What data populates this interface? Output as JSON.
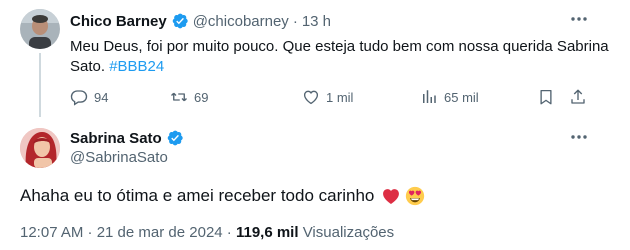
{
  "parent_tweet": {
    "author_name": "Chico Barney",
    "handle": "@chicobarney",
    "separator": "·",
    "time_ago": "13 h",
    "text_main": "Meu Deus, foi por muito pouco. Que esteja tudo bem com nossa querida Sabrina Sato.",
    "hashtag": "#BBB24",
    "actions": {
      "replies": "94",
      "retweets": "69",
      "likes": "1 mil",
      "views": "65 mil"
    },
    "icons": {
      "verified": "verified-badge-icon",
      "more": "more-icon",
      "reply": "reply-icon",
      "retweet": "retweet-icon",
      "like": "heart-icon",
      "views": "views-icon",
      "bookmark": "bookmark-icon",
      "share": "share-icon"
    }
  },
  "main_tweet": {
    "author_name": "Sabrina Sato",
    "handle": "@SabrinaSato",
    "text": "Ahaha eu to ótima e amei receber todo carinho",
    "emojis": [
      "red-heart-icon",
      "heart-eyes-icon"
    ],
    "timestamp": "12:07 AM · 21 de mar de 2024 ·",
    "views_count": "119,6 mil",
    "views_label": "Visualizações"
  },
  "colors": {
    "accent": "#1d9bf0",
    "text": "#0f1419",
    "secondary": "#536471",
    "thread_line": "#cfd9de"
  }
}
